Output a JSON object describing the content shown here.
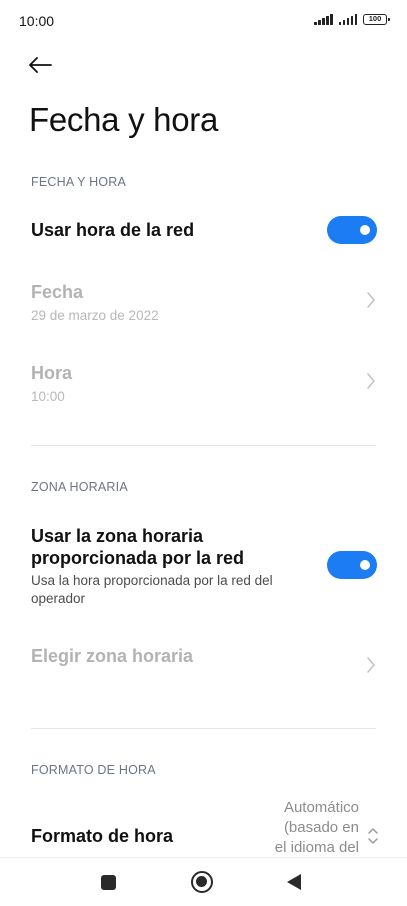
{
  "status_bar": {
    "time": "10:00",
    "battery": "100"
  },
  "page": {
    "title": "Fecha y hora"
  },
  "sections": {
    "date_time": {
      "header": "FECHA Y HORA",
      "network_time": {
        "title": "Usar hora de la red",
        "enabled": true
      },
      "date": {
        "title": "Fecha",
        "value": "29 de marzo de 2022"
      },
      "time": {
        "title": "Hora",
        "value": "10:00"
      }
    },
    "time_zone": {
      "header": "ZONA HORARIA",
      "network_zone": {
        "title_line1": "Usar la zona horaria",
        "title_line2": "proporcionada por la red",
        "subtitle_line1": "Usa la hora proporcionada por la red del",
        "subtitle_line2": "operador",
        "enabled": true
      },
      "choose_zone": {
        "title": "Elegir zona horaria"
      }
    },
    "time_format": {
      "header": "FORMATO DE HORA",
      "format": {
        "title": "Formato de hora",
        "value_line1": "Automático",
        "value_line2": "(basado en",
        "value_line3": "el idioma del"
      }
    }
  },
  "colors": {
    "accent": "#1b7cf3",
    "section_header": "#6e7487",
    "disabled_text": "#b3b3b3"
  },
  "icons": {
    "back": "arrow-left-icon",
    "chevron": "chevron-right-icon",
    "format_chevron": "chevron-up-down-icon"
  }
}
